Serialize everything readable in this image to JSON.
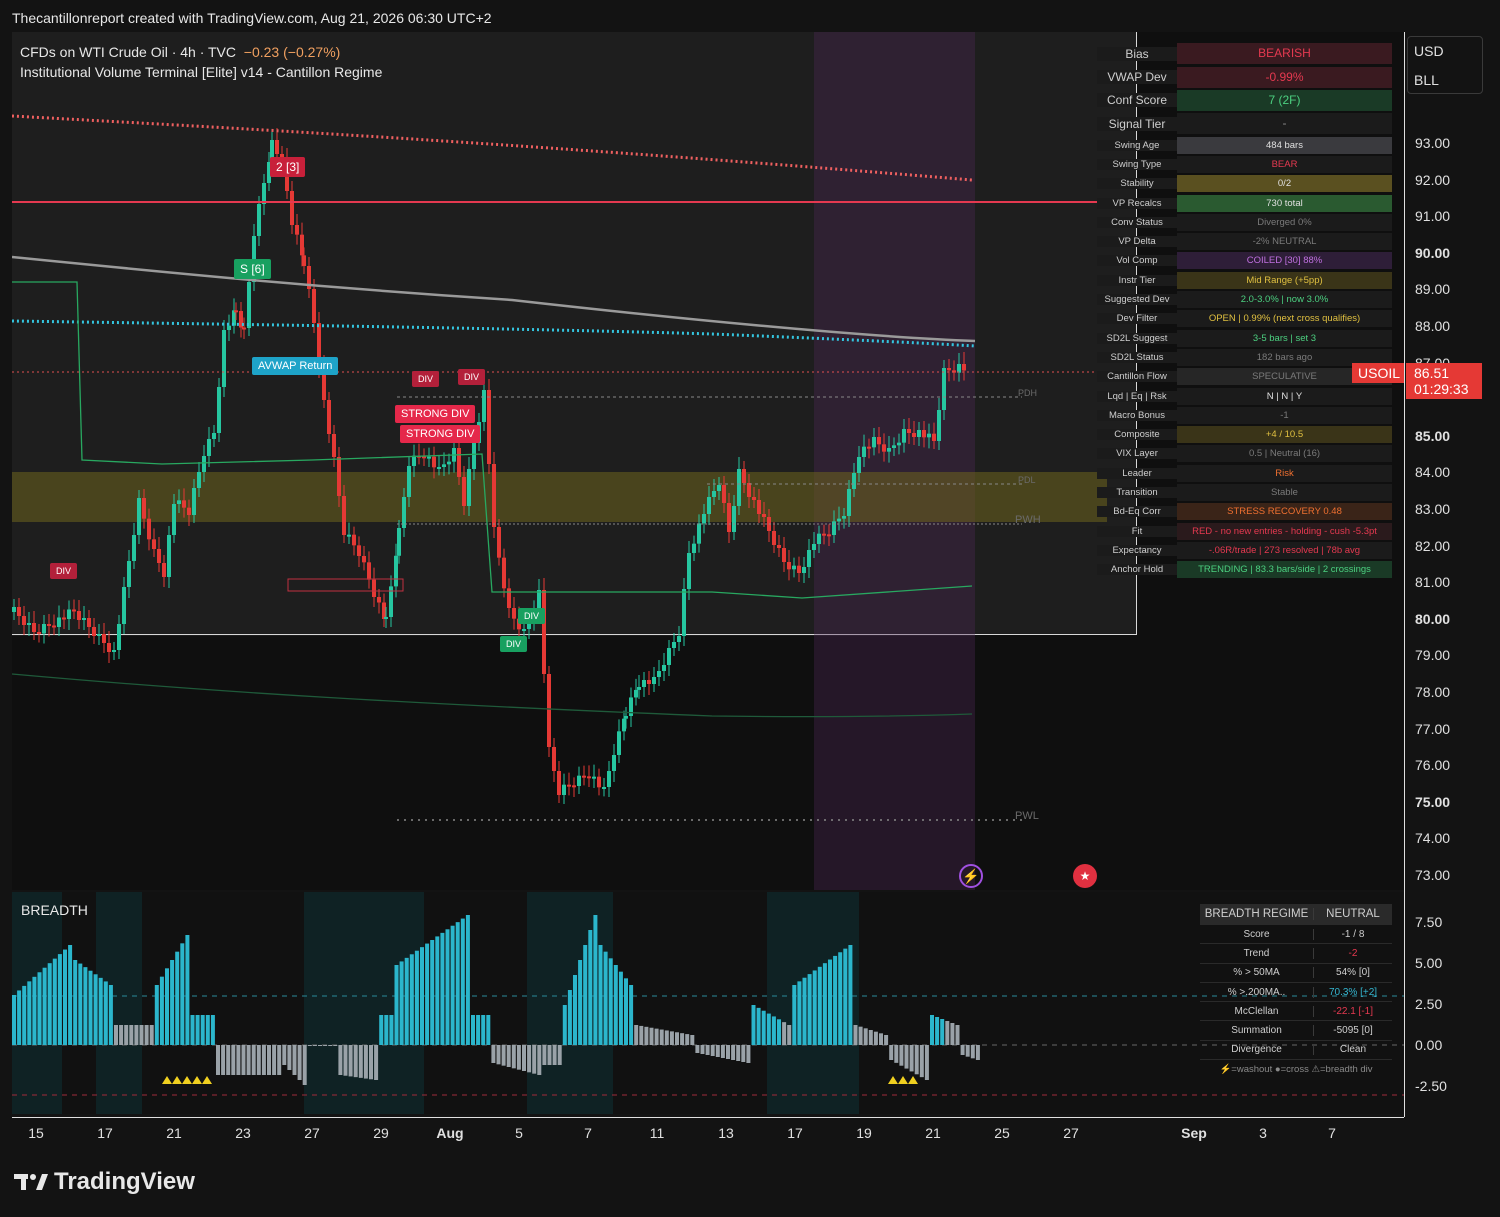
{
  "header": {
    "credit": "Thecantillonreport created with TradingView.com, Aug 21, 2026 06:30 UTC+2"
  },
  "legend": {
    "symbol_line": "CFDs on WTI Crude Oil · 4h · TVC",
    "change": "−0.23 (−0.27%)",
    "indicator": "Institutional Volume Terminal [Elite] v14 - Cantillon Regime"
  },
  "chart_labels": {
    "avwap": "AVWAP Return",
    "div": "DIV",
    "strong_div_1": "STRONG DIV",
    "strong_div_2": "STRONG DIV",
    "sell_tag": "2 [3]",
    "buy_tag": "S  [6]",
    "pdh": "PDH",
    "pdl": "PDL",
    "pwh": "PWH",
    "pwl": "PWL"
  },
  "stats_table": [
    {
      "k": "Bias",
      "v": "BEARISH",
      "color": "#e53950",
      "bg": "#3a1a20",
      "big": true
    },
    {
      "k": "VWAP Dev",
      "v": "-0.99%",
      "color": "#e53950",
      "bg": "#3a1a20",
      "big": true
    },
    {
      "k": "Conf Score",
      "v": "7 (2F)",
      "color": "#4cd080",
      "bg": "#1a3a26",
      "big": true
    },
    {
      "k": "Signal Tier",
      "v": "-",
      "color": "#8a8a8a",
      "bg": "#1b1b1b",
      "big": true
    },
    {
      "k": "Swing Age",
      "v": "484 bars",
      "color": "#e0e0e0",
      "bg": "#3a3a3e"
    },
    {
      "k": "Swing Type",
      "v": "BEAR",
      "color": "#e53950",
      "bg": "#1b1b1b"
    },
    {
      "k": "Stability",
      "v": "0/2",
      "color": "#e0e0e0",
      "bg": "#5a5020"
    },
    {
      "k": "VP Recalcs",
      "v": "730 total",
      "color": "#e0e0e0",
      "bg": "#2a5a30"
    },
    {
      "k": "Conv Status",
      "v": "Diverged 0%",
      "color": "#7a7a7a",
      "bg": "#1b1b1b"
    },
    {
      "k": "VP Delta",
      "v": "-2% NEUTRAL",
      "color": "#7a7a7a",
      "bg": "#1b1b1b"
    },
    {
      "k": "Vol Comp",
      "v": "COILED [30] 88%",
      "color": "#c070e0",
      "bg": "#2e1e38"
    },
    {
      "k": "Instr Tier",
      "v": "Mid Range (+5pp)",
      "color": "#e0c040",
      "bg": "#3a3418"
    },
    {
      "k": "Suggested Dev",
      "v": "2.0-3.0% | now 3.0%",
      "color": "#4cd080",
      "bg": "#1b1b1b"
    },
    {
      "k": "Dev Filter",
      "v": "OPEN | 0.99% (next cross qualifies)",
      "color": "#e0c040",
      "bg": "#1b1b1b"
    },
    {
      "k": "SD2L Suggest",
      "v": "3-5 bars | set 3",
      "color": "#4cd080",
      "bg": "#1b1b1b"
    },
    {
      "k": "SD2L Status",
      "v": "182 bars ago",
      "color": "#7a7a7a",
      "bg": "#1b1b1b"
    },
    {
      "k": "Cantillon Flow",
      "v": "SPECULATIVE",
      "color": "#7a7a7a",
      "bg": "#262626"
    },
    {
      "k": "Lqd | Eq | Rsk",
      "v": "N | N | Y",
      "color": "#e0e0e0",
      "bg": "#1b1b1b"
    },
    {
      "k": "Macro Bonus",
      "v": "-1",
      "color": "#7a7a7a",
      "bg": "#1b1b1b"
    },
    {
      "k": "Composite",
      "v": "+4 / 10.5",
      "color": "#e0c040",
      "bg": "#3a3418"
    },
    {
      "k": "VIX Layer",
      "v": "0.5 | Neutral (16)",
      "color": "#7a7a7a",
      "bg": "#1b1b1b"
    },
    {
      "k": "Leader",
      "v": "Risk",
      "color": "#f07030",
      "bg": "#1b1b1b"
    },
    {
      "k": "Transition",
      "v": "Stable",
      "color": "#7a7a7a",
      "bg": "#1b1b1b"
    },
    {
      "k": "Bd-Eq Corr",
      "v": "STRESS RECOVERY 0.48",
      "color": "#f07030",
      "bg": "#3a2418"
    },
    {
      "k": "Fit",
      "v": "RED - no new entries - holding - cush -5.3pt",
      "color": "#e53950",
      "bg": "#2a1a1c"
    },
    {
      "k": "Expectancy",
      "v": "-.06R/trade | 273 resolved | 78b avg",
      "color": "#e53950",
      "bg": "#1b1b1b"
    },
    {
      "k": "Anchor Hold",
      "v": "TRENDING | 83.3 bars/side | 2 crossings",
      "color": "#4cd080",
      "bg": "#1a3a26"
    }
  ],
  "price_axis": {
    "currency": "USD",
    "unit": "BLL",
    "ticks": [
      "93.00",
      "92.00",
      "91.00",
      "90.00",
      "89.00",
      "88.00",
      "87.00",
      "85.00",
      "84.00",
      "83.00",
      "82.00",
      "81.00",
      "80.00",
      "79.00",
      "78.00",
      "77.00",
      "76.00",
      "75.00",
      "74.00",
      "73.00"
    ],
    "bold_ticks": [
      "90.00",
      "85.00",
      "80.00",
      "75.00"
    ],
    "symbol_tag": "USOIL",
    "last_price": "86.51",
    "countdown": "01:29:33"
  },
  "breadth": {
    "title": "BREADTH",
    "ticks": [
      "7.50",
      "5.00",
      "2.50",
      "0.00",
      "-2.50"
    ],
    "table_header": {
      "k": "BREADTH REGIME",
      "v": "NEUTRAL"
    },
    "table": [
      {
        "k": "Score",
        "v": "-1 / 8",
        "color": "#cfcfcf"
      },
      {
        "k": "Trend",
        "v": "-2",
        "color": "#e53950"
      },
      {
        "k": "% > 50MA",
        "v": "54%  [0]",
        "color": "#cfcfcf"
      },
      {
        "k": "% >.200MA..",
        "v": "70.3%  [+2]",
        "color": "#34b6d0"
      },
      {
        "k": "McClellan",
        "v": "-22.1  [-1]",
        "color": "#e53950"
      },
      {
        "k": "Summation",
        "v": "-5095  [0]",
        "color": "#cfcfcf"
      },
      {
        "k": "Divergence",
        "v": "Clean",
        "color": "#cfcfcf"
      }
    ],
    "footer": "⚡=washout  ●=cross  ⚠=breadth div"
  },
  "time_axis": [
    {
      "label": "15"
    },
    {
      "label": "17"
    },
    {
      "label": "21"
    },
    {
      "label": "23"
    },
    {
      "label": "27"
    },
    {
      "label": "29"
    },
    {
      "label": "Aug",
      "bold": true
    },
    {
      "label": "5"
    },
    {
      "label": "7"
    },
    {
      "label": "11"
    },
    {
      "label": "13"
    },
    {
      "label": "17"
    },
    {
      "label": "19"
    },
    {
      "label": "21"
    },
    {
      "label": "25"
    },
    {
      "label": "27"
    },
    {
      "label": "Sep",
      "bold": true
    },
    {
      "label": "3"
    },
    {
      "label": "7"
    }
  ],
  "footer": {
    "brand": "TradingView"
  }
}
